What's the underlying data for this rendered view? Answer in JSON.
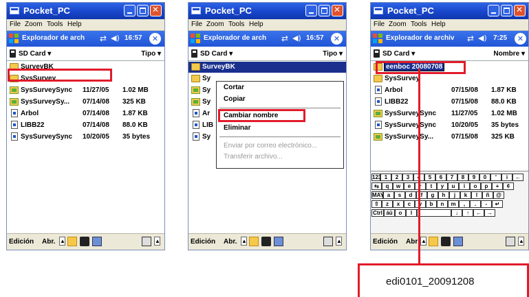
{
  "screens": [
    {
      "title": "Pocket_PC",
      "menu": [
        "File",
        "Zoom",
        "Tools",
        "Help"
      ],
      "nav_title": "Explorador de arch",
      "clock": "16:57",
      "location": "SD Card",
      "sort": "Tipo",
      "rows": [
        {
          "name": "SurveyBK",
          "date": "",
          "size": "",
          "icon": "folder-icon"
        },
        {
          "name": "SysSurvey",
          "date": "",
          "size": "",
          "icon": "folder-icon"
        },
        {
          "name": "SysSurveySync",
          "date": "11/27/05",
          "size": "1.02 MB",
          "icon": "sync-file-icon"
        },
        {
          "name": "SysSurveySy...",
          "date": "07/14/08",
          "size": "325 KB",
          "icon": "sync-file-icon"
        },
        {
          "name": "Arbol",
          "date": "07/14/08",
          "size": "1.87 KB",
          "icon": "file-icon"
        },
        {
          "name": "LIBB22",
          "date": "07/14/08",
          "size": "88.0 KB",
          "icon": "file-icon"
        },
        {
          "name": "SysSurveySync",
          "date": "10/20/05",
          "size": "35 bytes",
          "icon": "file-icon"
        }
      ],
      "bottom": {
        "edit": "Edición",
        "open": "Abr."
      }
    },
    {
      "title": "Pocket_PC",
      "menu": [
        "File",
        "Zoom",
        "Tools",
        "Help"
      ],
      "nav_title": "Explorador de arch",
      "clock": "16:57",
      "location": "SD Card",
      "sort": "Tipo",
      "selected": "SurveyBK",
      "row_stubs": [
        "Sy",
        "Sy",
        "Sy",
        "Ar",
        "LIB",
        "Sy"
      ],
      "context_menu": [
        "Cortar",
        "Copiar",
        "Cambiar nombre",
        "Eliminar",
        "Enviar por correo electrónico...",
        "Transferir archivo..."
      ],
      "bottom": {
        "edit": "Edición",
        "open": "Abr."
      }
    },
    {
      "title": "Pocket_PC",
      "menu": [
        "File",
        "Zoom",
        "Tools",
        "Help"
      ],
      "nav_title": "Explorador de archiv",
      "clock": "7:25",
      "location": "SD Card",
      "sort": "Nombre",
      "rename_value": "eenboc 20080708",
      "rows": [
        {
          "name": "SysSurvey",
          "date": "",
          "size": "",
          "icon": "folder-icon"
        },
        {
          "name": "Arbol",
          "date": "07/15/08",
          "size": "1.87 KB",
          "icon": "file-icon"
        },
        {
          "name": "LIBB22",
          "date": "07/15/08",
          "size": "88.0 KB",
          "icon": "file-icon"
        },
        {
          "name": "SysSurveySync",
          "date": "11/27/05",
          "size": "1.02 MB",
          "icon": "sync-file-icon"
        },
        {
          "name": "SysSurveySync",
          "date": "10/20/05",
          "size": "35 bytes",
          "icon": "file-icon"
        },
        {
          "name": "SysSurveySy...",
          "date": "07/15/08",
          "size": "325 KB",
          "icon": "sync-file-icon"
        }
      ],
      "keyboard": [
        [
          "123",
          "1",
          "2",
          "3",
          "4",
          "5",
          "6",
          "7",
          "8",
          "9",
          "0",
          "'",
          "i",
          "←"
        ],
        [
          "⇆",
          "q",
          "w",
          "e",
          "r",
          "t",
          "y",
          "u",
          "i",
          "o",
          "p",
          "+",
          "¢"
        ],
        [
          "MAY",
          "a",
          "s",
          "d",
          "f",
          "g",
          "h",
          "j",
          "k",
          "l",
          "ñ",
          "@"
        ],
        [
          "⇧",
          "z",
          "x",
          "c",
          "v",
          "b",
          "n",
          "m",
          ",",
          ".",
          "-",
          "↵"
        ],
        [
          "Ctrl",
          "áü",
          "o",
          "l",
          "",
          "↓",
          "↑",
          "←",
          "→"
        ]
      ],
      "bottom": {
        "edit": "Edición",
        "open": "Abr"
      }
    }
  ],
  "callout": {
    "text": "edi0101_20091208"
  },
  "colors": {
    "highlight": "#e21a2a",
    "titlebar": "#1744c8",
    "selection": "#1a2f8e"
  }
}
